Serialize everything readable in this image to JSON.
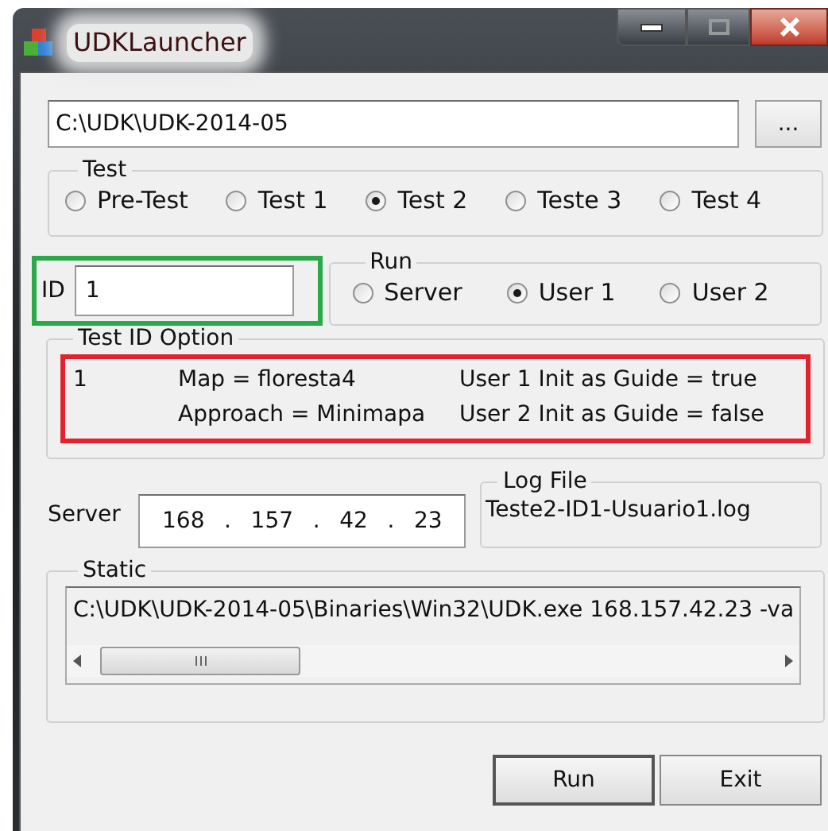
{
  "window": {
    "title": "UDKLauncher"
  },
  "path_field": {
    "value": "C:\\UDK\\UDK-2014-05"
  },
  "browse_button": {
    "label": "..."
  },
  "test_group": {
    "title": "Test",
    "options": [
      {
        "label": "Pre-Test",
        "selected": false
      },
      {
        "label": "Test 1",
        "selected": false
      },
      {
        "label": "Test 2",
        "selected": true
      },
      {
        "label": "Teste 3",
        "selected": false
      },
      {
        "label": "Test 4",
        "selected": false
      }
    ]
  },
  "id_field": {
    "label": "ID",
    "value": "1"
  },
  "run_group": {
    "title": "Run",
    "options": [
      {
        "label": "Server",
        "selected": false
      },
      {
        "label": "User 1",
        "selected": true
      },
      {
        "label": "User 2",
        "selected": false
      }
    ]
  },
  "test_id_option": {
    "title": "Test ID Option",
    "id": "1",
    "column_2": [
      "Map = floresta4",
      "Approach = Minimapa"
    ],
    "column_3": [
      "User 1 Init as Guide = true",
      "User 2 Init as Guide = false"
    ]
  },
  "server": {
    "label": "Server",
    "address_parts": [
      "168",
      ".",
      "157",
      ".",
      "42",
      ".",
      "23"
    ]
  },
  "log_file": {
    "title": "Log File",
    "value": "Teste2-ID1-Usuario1.log"
  },
  "static": {
    "title": "Static",
    "value": "C:\\UDK\\UDK-2014-05\\Binaries\\Win32\\UDK.exe 168.157.42.23 -va"
  },
  "buttons": [
    {
      "label": "Run",
      "default": true
    },
    {
      "label": "Exit",
      "default": false
    }
  ]
}
